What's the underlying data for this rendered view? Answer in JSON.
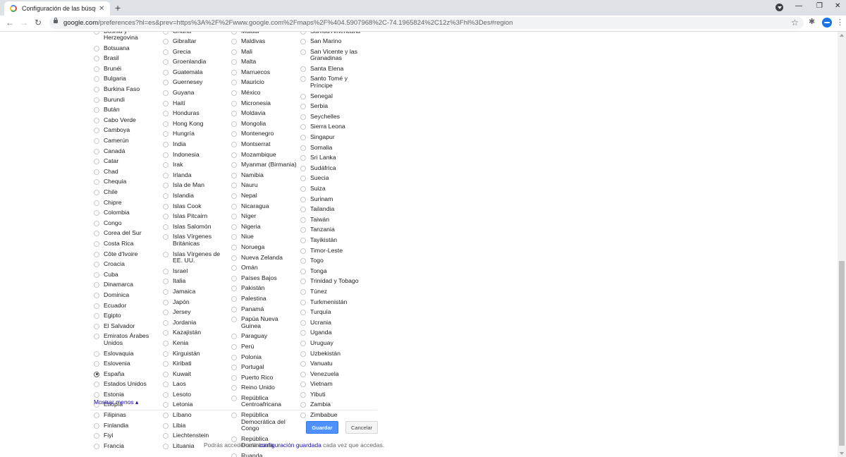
{
  "browser": {
    "tab_title": "Configuración de las búsquedas",
    "url_host": "google.com",
    "url_rest": "/preferences?hl=es&prev=https%3A%2F%2Fwww.google.com%2Fmaps%2F%404.5907968%2C-74.1965824%2C12z%3Fhl%3Des#region"
  },
  "regions": {
    "columns": [
      [
        "Bosnia y Herzegovina",
        "Botsuana",
        "Brasil",
        "Brunéi",
        "Bulgaria",
        "Burkina Faso",
        "Burundi",
        "Bután",
        "Cabo Verde",
        "Camboya",
        "Camerún",
        "Canadá",
        "Catar",
        "Chad",
        "Chequia",
        "Chile",
        "Chipre",
        "Colombia",
        "Congo",
        "Corea del Sur",
        "Costa Rica",
        "Côte d'Ivoire",
        "Croacia",
        "Cuba",
        "Dinamarca",
        "Dominica",
        "Ecuador",
        "Egipto",
        "El Salvador",
        "Emiratos Árabes Unidos",
        "Eslovaquia",
        "Eslovenia",
        "España",
        "Estados Unidos",
        "Estonia",
        "Etiopía",
        "Filipinas",
        "Finlandia",
        "Fiyi",
        "Francia"
      ],
      [
        "Ghana",
        "Gibraltar",
        "Grecia",
        "Groenlandia",
        "Guatemala",
        "Guernesey",
        "Guyana",
        "Haití",
        "Honduras",
        "Hong Kong",
        "Hungría",
        "India",
        "Indonesia",
        "Irak",
        "Irlanda",
        "Isla de Man",
        "Islandia",
        "Islas Cook",
        "Islas Pitcairn",
        "Islas Salomón",
        "Islas Vírgenes Británicas",
        "Islas Vírgenes de EE. UU.",
        "Israel",
        "Italia",
        "Jamaica",
        "Japón",
        "Jersey",
        "Jordania",
        "Kazajistán",
        "Kenia",
        "Kirguistán",
        "Kiribati",
        "Kuwait",
        "Laos",
        "Lesoto",
        "Letonia",
        "Líbano",
        "Libia",
        "Liechtenstein",
        "Lituania"
      ],
      [
        "Malaui",
        "Maldivas",
        "Mali",
        "Malta",
        "Marruecos",
        "Mauricio",
        "México",
        "Micronesia",
        "Moldavia",
        "Mongolia",
        "Montenegro",
        "Montserrat",
        "Mozambique",
        "Myanmar (Birmania)",
        "Namibia",
        "Nauru",
        "Nepal",
        "Nicaragua",
        "Níger",
        "Nigeria",
        "Niue",
        "Noruega",
        "Nueva Zelanda",
        "Omán",
        "Países Bajos",
        "Pakistán",
        "Palestina",
        "Panamá",
        "Papúa Nueva Guinea",
        "Paraguay",
        "Perú",
        "Polonia",
        "Portugal",
        "Puerto Rico",
        "Reino Unido",
        "República Centroafricana",
        "República Democrática del Congo",
        "República Dominicana",
        "Ruanda"
      ],
      [
        "Samoa Americana",
        "San Marino",
        "San Vicente y las Granadinas",
        "Santa Elena",
        "Santo Tomé y Príncipe",
        "Senegal",
        "Serbia",
        "Seychelles",
        "Sierra Leona",
        "Singapur",
        "Somalia",
        "Sri Lanka",
        "Sudáfrica",
        "Suecia",
        "Suiza",
        "Surinam",
        "Tailandia",
        "Taiwán",
        "Tanzania",
        "Tayikistán",
        "Timor-Leste",
        "Togo",
        "Tonga",
        "Trinidad y Tobago",
        "Túnez",
        "Turkmenistán",
        "Turquía",
        "Ucrania",
        "Uganda",
        "Uruguay",
        "Uzbekistán",
        "Vanuatu",
        "Venezuela",
        "Vietnam",
        "Yibuti",
        "Zambia",
        "Zimbabue"
      ]
    ],
    "selected": "España",
    "show_less": "Mostrar menos ▴"
  },
  "actions": {
    "save": "Guardar",
    "cancel": "Cancelar"
  },
  "footnote": {
    "before": "Podrás acceder a la ",
    "link": "configuración guardada",
    "after": " cada vez que accedas."
  },
  "colors": {
    "accent": "#4d90fe",
    "link": "#1a0dab"
  }
}
